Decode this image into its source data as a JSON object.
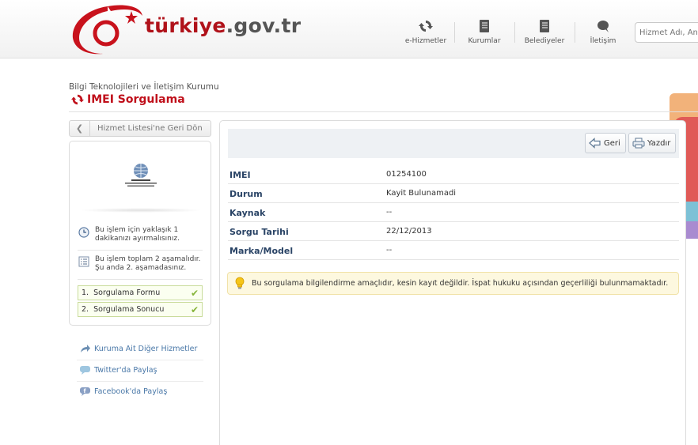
{
  "header": {
    "logo_name": "türkiye",
    "logo_tld": ".gov.tr",
    "nav": [
      {
        "label": "e-Hizmetler",
        "icon": "refresh-icon"
      },
      {
        "label": "Kurumlar",
        "icon": "book-icon"
      },
      {
        "label": "Belediyeler",
        "icon": "book-icon"
      },
      {
        "label": "İletişim",
        "icon": "chat-icon"
      }
    ],
    "search_placeholder": "Hizmet Adı, Ana"
  },
  "page": {
    "institution": "Bilgi Teknolojileri ve İletişim Kurumu",
    "title": "IMEI Sorgulama"
  },
  "sidebar": {
    "back_label": "Hizmet Listesi'ne Geri Dön",
    "info": [
      {
        "text": "Bu işlem için yaklaşık 1 dakikanızı ayırmalısınız.",
        "icon": "clock-icon"
      },
      {
        "text": "Bu işlem toplam 2 aşamalıdır. Şu anda 2. aşamadasınız.",
        "icon": "list-icon"
      }
    ],
    "steps": [
      {
        "number": "1.",
        "label": "Sorgulama Formu"
      },
      {
        "number": "2.",
        "label": "Sorgulama Sonucu"
      }
    ],
    "links": [
      {
        "label": "Kuruma Ait Diğer Hizmetler",
        "icon": "share-arrow-icon"
      },
      {
        "label": "Twitter'da Paylaş",
        "icon": "speech-bubble-icon"
      },
      {
        "label": "Facebook'da Paylaş",
        "icon": "facebook-icon"
      }
    ]
  },
  "main": {
    "back_button": "Geri",
    "print_button": "Yazdır",
    "rows": [
      {
        "key": "IMEI",
        "value": "01254100"
      },
      {
        "key": "Durum",
        "value": "Kayit Bulunamadi"
      },
      {
        "key": "Kaynak",
        "value": "--"
      },
      {
        "key": "Sorgu Tarihi",
        "value": "22/12/2013"
      },
      {
        "key": "Marka/Model",
        "value": "--"
      }
    ],
    "notice": "Bu sorgulama bilgilendirme amaçlıdır, kesin kayıt değildir. İspat hukuku açısından geçerliliği bulunmamaktadır."
  },
  "colors": {
    "brand_red": "#c0101b",
    "label_blue": "#2a4466",
    "link_blue": "#4a78a8",
    "notice_bg": "#fdf8df",
    "step_check": "#86b43a"
  }
}
